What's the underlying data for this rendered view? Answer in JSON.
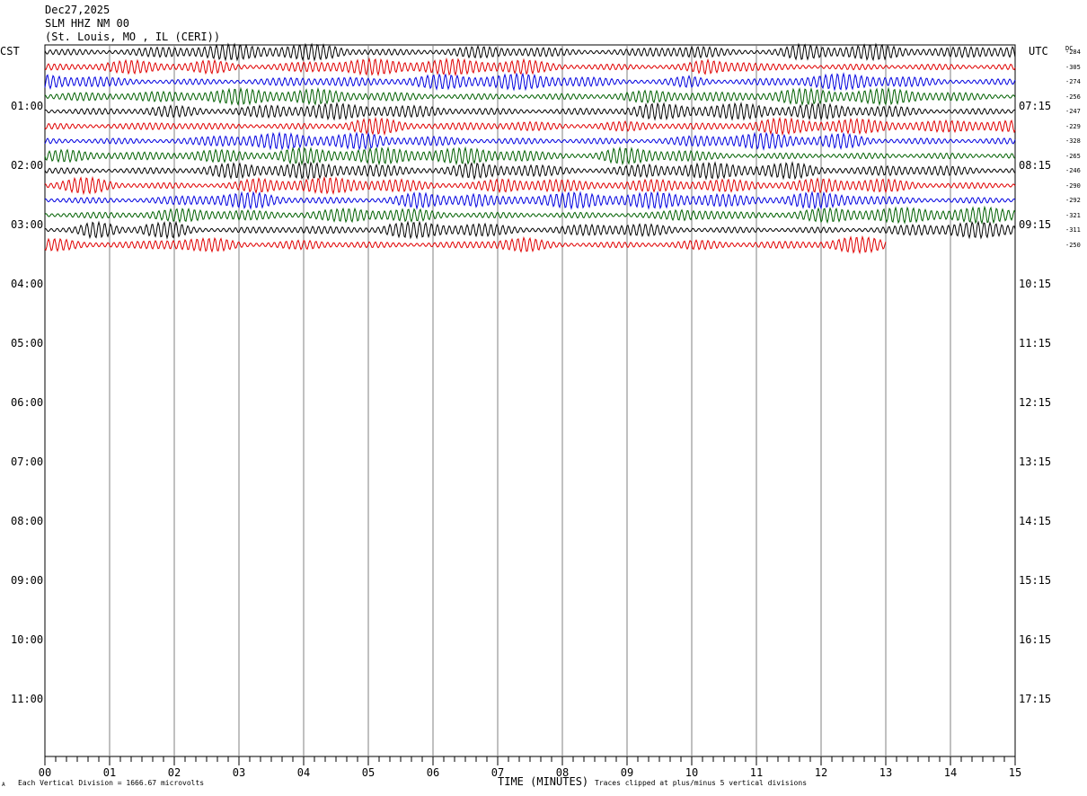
{
  "header": {
    "date": "Dec27,2025",
    "station": "SLM HHZ NM 00",
    "location": "(St. Louis, MO , IL (CERI))"
  },
  "left_zone": "CST",
  "right_zone": "UTC",
  "dc_header": "DC",
  "footer": {
    "scale_note": "Each Vertical Division = 1666.67 microvolts",
    "clip_note": "Traces clipped at plus/minus 5 vertical divisions",
    "corner_mark": "A"
  },
  "chart_data": {
    "type": "line",
    "xlabel": "TIME (MINUTES)",
    "xlim": [
      0,
      15
    ],
    "x_ticks": [
      "00",
      "01",
      "02",
      "03",
      "04",
      "05",
      "06",
      "07",
      "08",
      "09",
      "10",
      "11",
      "12",
      "13",
      "14",
      "15"
    ],
    "left_time_labels": [
      "01:00",
      "02:00",
      "03:00",
      "04:00",
      "05:00",
      "06:00",
      "07:00",
      "08:00",
      "09:00",
      "10:00",
      "11:00"
    ],
    "right_time_labels": [
      "07:15",
      "08:15",
      "09:15",
      "10:15",
      "11:15",
      "12:15",
      "13:15",
      "14:15",
      "15:15",
      "16:15",
      "17:15"
    ],
    "trace_colors": [
      "#000000",
      "#e00000",
      "#0000e0",
      "#006000"
    ],
    "traces": [
      {
        "dc": "284",
        "color": "#000000",
        "end_minute": 15
      },
      {
        "dc": "305",
        "color": "#e00000",
        "end_minute": 15
      },
      {
        "dc": "274",
        "color": "#0000e0",
        "end_minute": 15
      },
      {
        "dc": "256",
        "color": "#006000",
        "end_minute": 15
      },
      {
        "dc": "247",
        "color": "#000000",
        "end_minute": 15
      },
      {
        "dc": "229",
        "color": "#e00000",
        "end_minute": 15
      },
      {
        "dc": "328",
        "color": "#0000e0",
        "end_minute": 15
      },
      {
        "dc": "265",
        "color": "#006000",
        "end_minute": 15
      },
      {
        "dc": "246",
        "color": "#000000",
        "end_minute": 15
      },
      {
        "dc": "290",
        "color": "#e00000",
        "end_minute": 15
      },
      {
        "dc": "292",
        "color": "#0000e0",
        "end_minute": 15
      },
      {
        "dc": "321",
        "color": "#006000",
        "end_minute": 15
      },
      {
        "dc": "311",
        "color": "#000000",
        "end_minute": 15
      },
      {
        "dc": "250",
        "color": "#e00000",
        "end_minute": 13
      }
    ]
  }
}
